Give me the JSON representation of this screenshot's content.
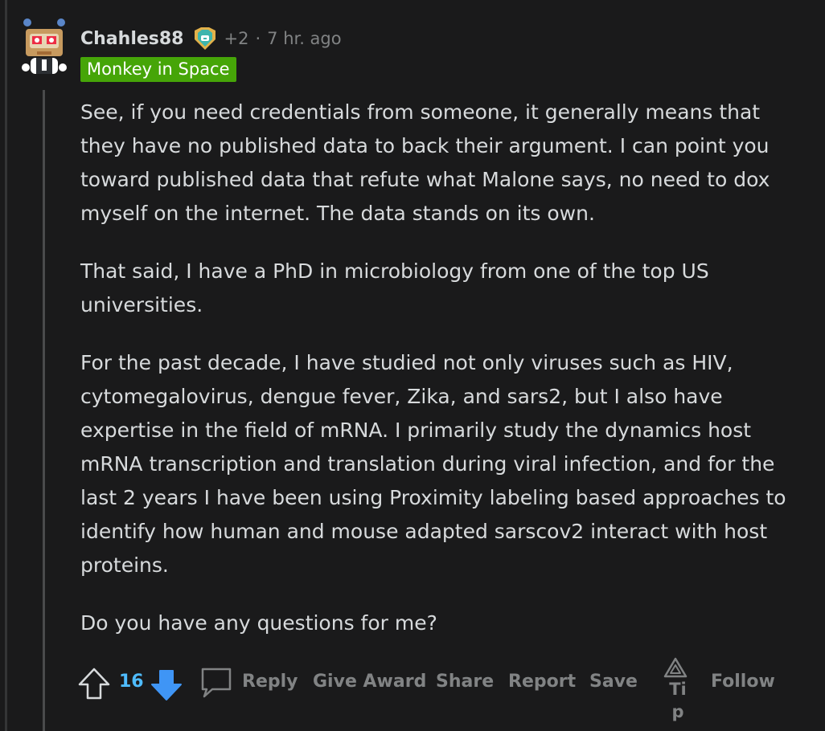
{
  "comment": {
    "username": "Chahles88",
    "award_count": "+2",
    "separator": "·",
    "timestamp": "7 hr. ago",
    "flair": "Monkey in Space",
    "paragraphs": [
      "See, if you need credentials from someone, it generally means that they have no published data to back their argument. I can point you toward published data that refute what Malone says, no need to dox myself on the internet. The data stands on its own.",
      "That said, I have a PhD in microbiology from one of the top US universities.",
      "For the past decade, I have studied not only viruses such as HIV, cytomegalovirus, dengue fever, Zika, and sars2, but I also have expertise in the field of mRNA. I primarily study the dynamics host mRNA transcription and translation during viral infection, and for the last 2 years I have been using Proximity labeling based approaches to identify how human and mouse adapted sarscov2 interact with host proteins.",
      "Do you have any questions for me?"
    ]
  },
  "actions": {
    "vote_count": "16",
    "reply": "Reply",
    "give_award": "Give Award",
    "share": "Share",
    "report": "Report",
    "save": "Save",
    "tip": "Tip",
    "follow": "Follow"
  },
  "icons": {
    "avatar": "snoo-robot-avatar",
    "award": "award-icon",
    "upvote": "upvote-arrow-icon",
    "downvote": "downvote-arrow-icon",
    "reply": "speech-bubble-icon",
    "tip": "tip-triangle-icon"
  },
  "colors": {
    "background": "#1a1a1b",
    "text": "#d7dadc",
    "muted": "#818384",
    "flair_bg": "#46a508",
    "vote_active": "#4fbcff"
  }
}
